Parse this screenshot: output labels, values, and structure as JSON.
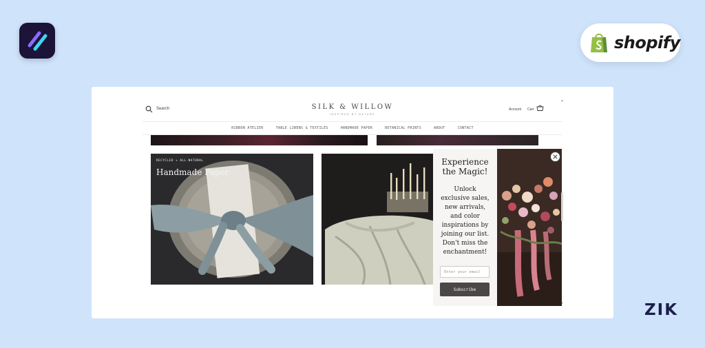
{
  "colors": {
    "background": "#cfe3fb",
    "app_badge_bg": "#1b1338",
    "app_stripe_1": "#8a6bff",
    "app_stripe_2": "#3fd6f2",
    "shopify_green": "#95bf47",
    "zik_color": "#1c1f4a",
    "popup_button": "#4a4746"
  },
  "badges": {
    "app_icon": "diagonal-stripes-icon",
    "shopify_icon": "shopping-bag-icon",
    "shopify_label": "shopify",
    "corner_label": "ZIK"
  },
  "site": {
    "header": {
      "search_label": "Search",
      "logo": "SILK & WILLOW",
      "tagline": "INSPIRED BY NATURE",
      "account_label": "Account",
      "cart_label": "Cart"
    },
    "nav": [
      {
        "label": "RIBBON ATELIER"
      },
      {
        "label": "TABLE LINENS & TEXTILES"
      },
      {
        "label": "HANDMADE PAPER"
      },
      {
        "label": "BOTANICAL PRINTS"
      },
      {
        "label": "ABOUT"
      },
      {
        "label": "CONTACT"
      }
    ],
    "tiles": [
      {
        "eyebrow": "RECYCLED + ALL-NATURAL",
        "title": "Handmade Paper"
      }
    ]
  },
  "popup": {
    "heading_line1": "Experience",
    "heading_line2": "the Magic!",
    "body_lines": [
      "Unlock",
      "exclusive sales,",
      "new arrivals,",
      "and color",
      "inspirations by",
      "joining our list.",
      "Don't miss the",
      "enchantment!"
    ],
    "email_placeholder": "Enter your email",
    "subscribe_label": "Subscribe"
  }
}
